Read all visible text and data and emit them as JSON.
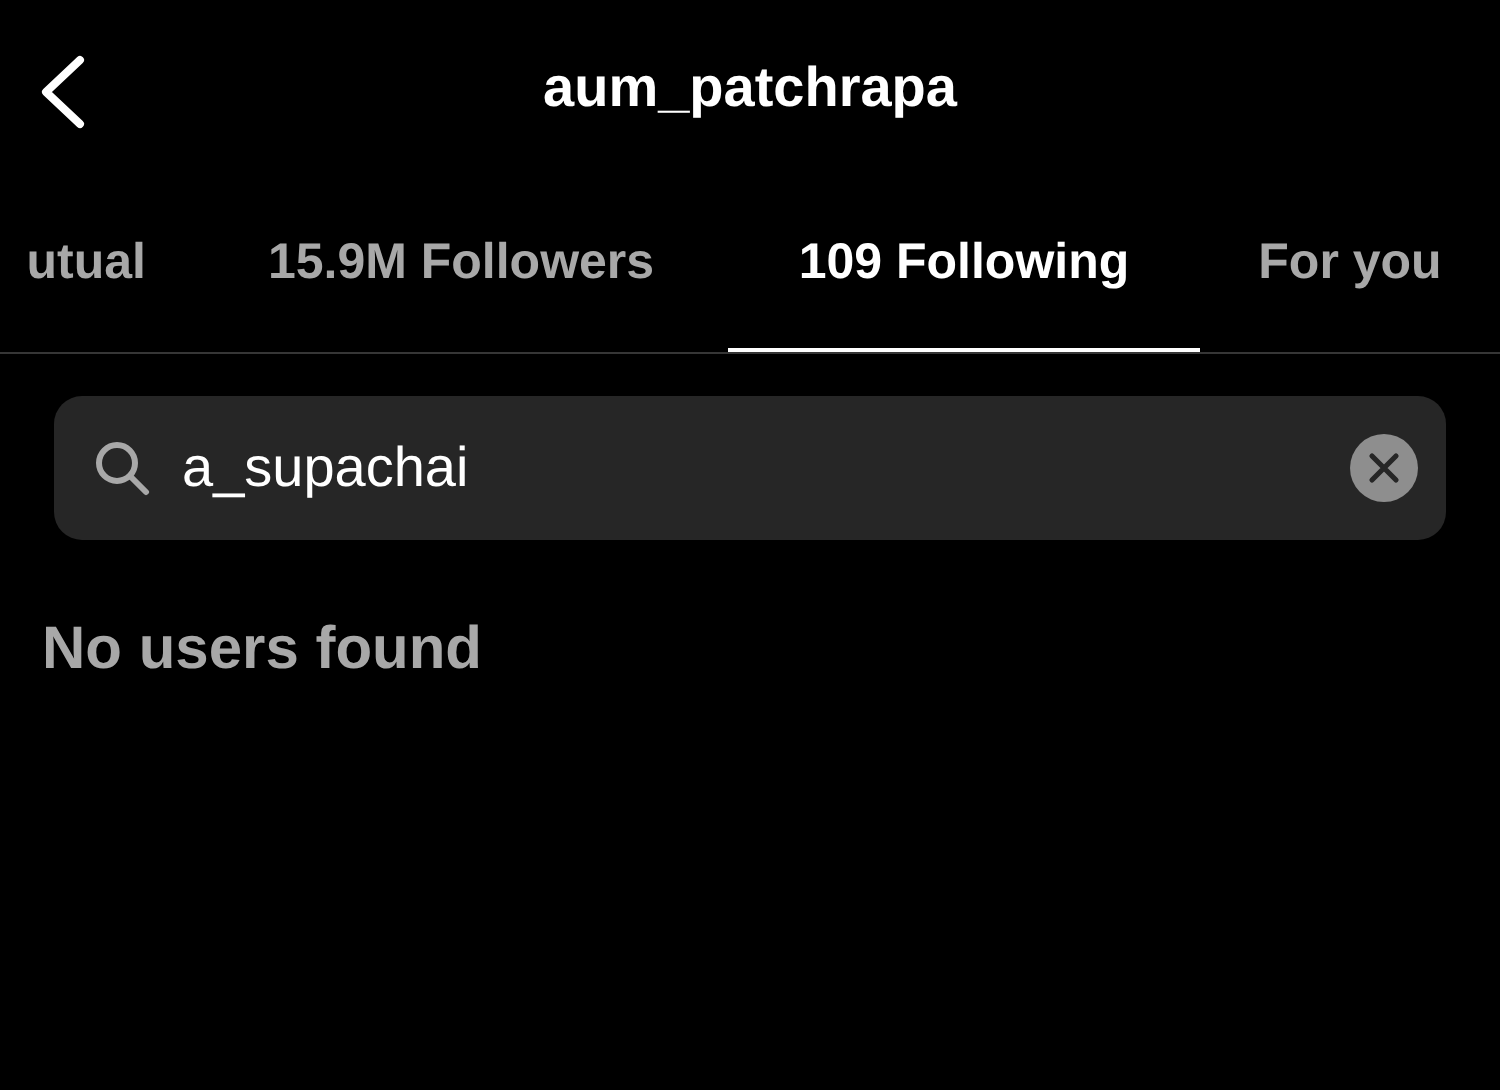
{
  "header": {
    "title": "aum_patchrapa"
  },
  "tabs": [
    {
      "label": "utual",
      "selected": false
    },
    {
      "label": "15.9M Followers",
      "selected": false
    },
    {
      "label": "109 Following",
      "selected": true
    },
    {
      "label": "For you",
      "selected": false
    }
  ],
  "search": {
    "value": "a_supachai"
  },
  "message": "No users found"
}
